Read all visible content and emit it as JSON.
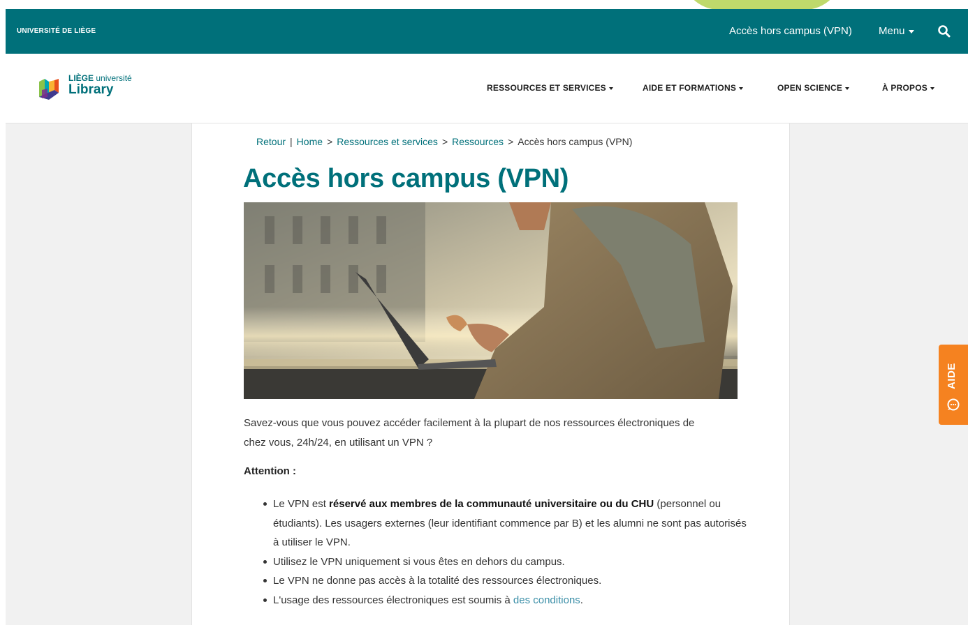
{
  "topbar": {
    "university": "UNIVERSITÉ DE LIÈGE",
    "vpn_link": "Accès hors campus (VPN)",
    "menu_label": "Menu",
    "search_icon": "search-icon",
    "color": "#00707a"
  },
  "logo": {
    "line1_bold": "LIÈGE",
    "line1_rest": " université",
    "line2": "Library"
  },
  "nav": {
    "items": [
      {
        "label": "RESSOURCES ET SERVICES"
      },
      {
        "label": "AIDE ET FORMATIONS"
      },
      {
        "label": "OPEN SCIENCE"
      },
      {
        "label": "À PROPOS"
      }
    ]
  },
  "breadcrumb": {
    "back": "Retour",
    "divider": "|",
    "items": [
      "Home",
      "Ressources et services",
      "Ressources"
    ],
    "current": "Accès hors campus (VPN)",
    "separator": ">"
  },
  "page": {
    "title": "Accès hors campus (VPN)",
    "intro": "Savez-vous que vous pouvez accéder facilement à la plupart de nos ressources électroniques de chez vous, 24h/24, en utilisant un VPN ?",
    "attention": "Attention :",
    "bullets": [
      {
        "before": "Le VPN est ",
        "bold": "réservé aux membres de la communauté universitaire ou du CHU",
        "after": " (personnel ou étudiants). Les usagers externes (leur identifiant commence par B) et les alumni ne sont pas autorisés à utiliser le VPN."
      },
      {
        "text": "Utilisez le VPN uniquement si vous êtes en dehors du campus."
      },
      {
        "text": "Le VPN ne donne pas accès à la totalité des ressources électroniques."
      },
      {
        "before": "L'usage des ressources électroniques est soumis à ",
        "link": "des conditions",
        "after": "."
      }
    ]
  },
  "aide": {
    "label": "AIDE",
    "icon": "chat-help-icon",
    "color": "#f58220"
  }
}
